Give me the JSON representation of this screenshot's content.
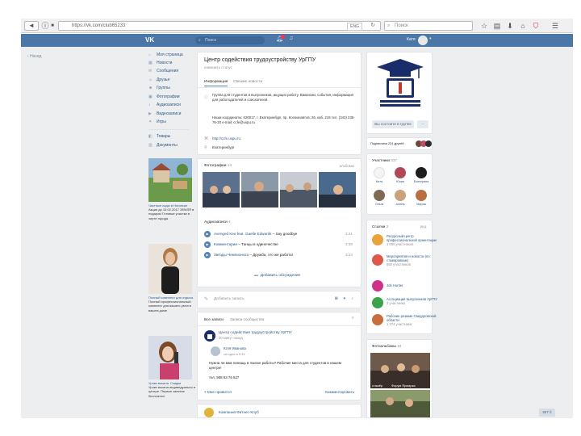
{
  "browser": {
    "url": "https://vk.com/club65233",
    "lang_badge": "ENG",
    "search_placeholder": "Поиск",
    "icons": [
      "back-icon",
      "info-icon",
      "lock-icon",
      "reload-icon",
      "star-icon",
      "library-icon",
      "download-icon",
      "home-icon",
      "pocket-icon",
      "menu-icon"
    ]
  },
  "vk_header": {
    "logo": "VK",
    "search_placeholder": "Поиск",
    "user_name": "Катя",
    "accent_color": "#4a76a8"
  },
  "left_nav": {
    "back_label": "Назад",
    "items": [
      {
        "icon": "home-icon",
        "label": "Моя страница"
      },
      {
        "icon": "news-icon",
        "label": "Новости"
      },
      {
        "icon": "messages-icon",
        "label": "Сообщения"
      },
      {
        "icon": "friends-icon",
        "label": "Друзья"
      },
      {
        "icon": "groups-icon",
        "label": "Группы"
      },
      {
        "icon": "photo-icon",
        "label": "Фотографии"
      },
      {
        "icon": "music-icon",
        "label": "Аудиозаписи"
      },
      {
        "icon": "video-icon",
        "label": "Видеозаписи"
      },
      {
        "icon": "games-icon",
        "label": "Игры"
      }
    ],
    "items2": [
      {
        "icon": "goods-icon",
        "label": "Товары"
      },
      {
        "icon": "docs-icon",
        "label": "Документы"
      }
    ]
  },
  "ads": [
    {
      "title": "Частные сады в Ногинске",
      "text": "Акция до 15.02.2017 ЗЕМЛЯ в подарок! Готовые участки в черте города"
    },
    {
      "title": "Полный комплект для отдыха",
      "text": "Полный профессиональный комплект для вашего уюта в вашем доме"
    },
    {
      "title": "Уроки вокала. Скидки",
      "text": "Уроки вокала индивидуально в центре. Первое занятие бесплатно!"
    }
  ],
  "group": {
    "title": "Центр содействия трудоустройству УрГПУ",
    "status": "изменить статус",
    "tabs": [
      "Информация",
      "Свежие новости"
    ],
    "description": "Группа для студентов и выпускников, ищущих работу. Вакансии, события, информация для работодателей и соискателей.",
    "address": "Наши координаты: 620017, г. Екатеринбург, пр. Космонавтов, 26, каб. 219 тел. (343) 235-76-20 e-mail: ccfe@uspu.ru",
    "site": "http://ccfe.uspu.ru",
    "city": "Екатеринбург"
  },
  "photos_block": {
    "title": "Фотографии",
    "count": "14",
    "albums_link": "альбомы"
  },
  "audio_block": {
    "title": "Аудиозаписи",
    "count": "4",
    "tracks": [
      {
        "artist": "Avenged Kee feat. Gaelle Edwards",
        "title": "Say goodbye",
        "duration": "3:41"
      },
      {
        "artist": "Комментарии",
        "title": "Танцы в одиночестве",
        "duration": "3:38"
      },
      {
        "artist": "Звёзды Чемпионата",
        "title": "Дружба, это же работа!",
        "duration": "3:24"
      }
    ],
    "discussion_label": "Добавить обсуждение"
  },
  "post_box": {
    "placeholder": "Добавить запись"
  },
  "wall": {
    "tabs": [
      "Все записи",
      "Записи сообщества"
    ],
    "post": {
      "author": "Центр содействия трудоустройству УрГПУ",
      "time": "20 минут назад",
      "repost_author": "Юля Иванова",
      "repost_time": "сегодня в 9:34",
      "text": "Нужна ли вам помощь в поиске работы? Рабочие места для студентов в нашем центре!",
      "phone": "тел. 908 63 76 527",
      "likes_label": "Мне нравится",
      "comment_label": "Комментировать"
    },
    "next_post_author": "Компания Фитнес-Клуб"
  },
  "right": {
    "join_button": "Вы состоите в группе",
    "friends_label": "Подписчики 224 друзей",
    "members_title": "Участники",
    "members_count": "837",
    "members": [
      "Катя",
      "Юлия",
      "Екатерина",
      "Ольга",
      "Алина",
      "Мария"
    ],
    "links_title": "Ссылки",
    "links_count": "3",
    "links_edit": "ред.",
    "links": [
      {
        "name": "Ресурсный центр профессиональной ориентации",
        "sub": "1 000 участников"
      },
      {
        "name": "Мероприятия и новости (по стажировкам)",
        "sub": "850 участников"
      },
      {
        "name": "Job Hunter",
        "sub": ""
      },
      {
        "name": "Ассоциация выпускников УрГПУ",
        "sub": "3 участника"
      },
      {
        "name": "Рабочие резюме Свердловской области",
        "sub": "1 074 участника"
      }
    ],
    "photo_albums_title": "Фотоальбомы",
    "photo_albums_count": "19",
    "albums": [
      "стажёр",
      "Форум Ярмарка"
    ]
  },
  "scroll_badge": "697 б"
}
